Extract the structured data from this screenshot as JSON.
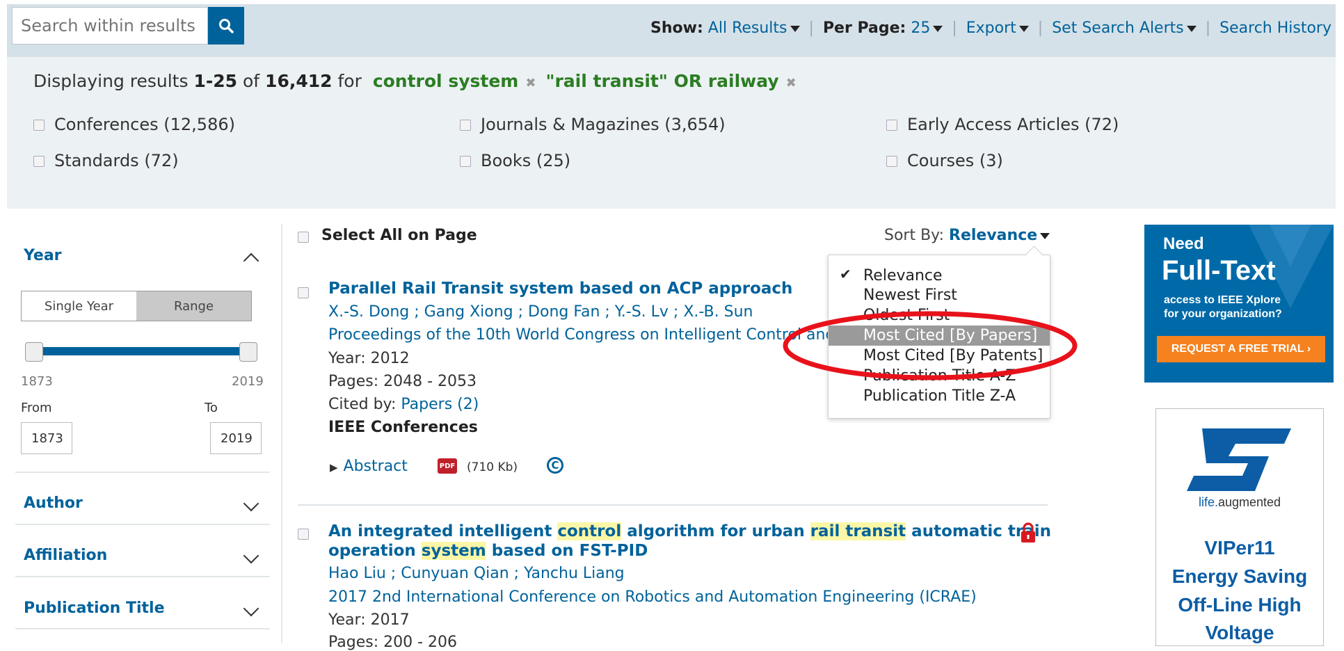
{
  "search": {
    "placeholder": "Search within results"
  },
  "toolbar": {
    "show_label": "Show:",
    "show_value": "All Results",
    "per_page_label": "Per Page:",
    "per_page_value": "25",
    "export": "Export",
    "alerts": "Set Search Alerts",
    "history": "Search History"
  },
  "results_summary": {
    "prefix": "Displaying results",
    "range": "1-25",
    "of": "of",
    "total": "16,412",
    "for": "for",
    "terms": [
      "control system",
      "\"rail transit\" OR railway"
    ]
  },
  "content_types": [
    {
      "label": "Conferences (12,586)"
    },
    {
      "label": "Journals & Magazines (3,654)"
    },
    {
      "label": "Early Access Articles (72)"
    },
    {
      "label": "Standards (72)"
    },
    {
      "label": "Books (25)"
    },
    {
      "label": "Courses (3)"
    }
  ],
  "sidebar": {
    "year": {
      "title": "Year",
      "single_label": "Single Year",
      "range_label": "Range",
      "min": "1873",
      "max": "2019",
      "from_label": "From",
      "to_label": "To",
      "from_value": "1873",
      "to_value": "2019"
    },
    "sections": [
      "Author",
      "Affiliation",
      "Publication Title"
    ]
  },
  "list": {
    "select_all": "Select All on Page",
    "sort_label": "Sort By:",
    "sort_value": "Relevance",
    "sort_options": [
      "Relevance",
      "Newest First",
      "Oldest First",
      "Most Cited [By Papers]",
      "Most Cited [By Patents]",
      "Publication Title A-Z",
      "Publication Title Z-A"
    ],
    "sort_highlighted": "Most Cited [By Papers]"
  },
  "results": [
    {
      "title": "Parallel Rail Transit system based on ACP approach",
      "authors": "X.-S. Dong ; Gang Xiong ; Dong Fan ; Y.-S. Lv ; X.-B. Sun",
      "venue": "Proceedings of the 10th World Congress on Intelligent Control and",
      "year": "Year: 2012",
      "pages": "Pages: 2048 - 2053",
      "cited_label": "Cited by:",
      "cited_link": "Papers (2)",
      "type": "IEEE Conferences",
      "abstract": "Abstract",
      "pdf_size": "(710 Kb)",
      "pdf_badge": "PDF"
    },
    {
      "title_parts": [
        "An integrated intelligent ",
        "control",
        " algorithm for urban ",
        "rail transit",
        " automatic train"
      ],
      "title_line2_parts": [
        "operation ",
        "system",
        " based on FST-PID"
      ],
      "authors": "Hao Liu ; Cunyuan Qian ; Yanchu Liang",
      "venue": "2017 2nd International Conference on Robotics and Automation Engineering (ICRAE)",
      "year": "Year: 2017",
      "pages": "Pages: 200 - 206"
    }
  ],
  "ads": {
    "ieee": {
      "line1": "Need",
      "line2": "Full-Text",
      "line3": "access to IEEE Xplore",
      "line4": "for your organization?",
      "cta": "REQUEST A FREE TRIAL ›"
    },
    "st": {
      "tagline_a": "life.",
      "tagline_b": "augmented",
      "line1": "VIPer11",
      "line2": "Energy Saving",
      "line3": "Off-Line High",
      "line4": "Voltage"
    }
  },
  "colors": {
    "link": "#00629b",
    "term": "#2b7d22",
    "highlight": "#fbf7a6",
    "annotation": "#e8121b",
    "lock": "#d71920"
  }
}
